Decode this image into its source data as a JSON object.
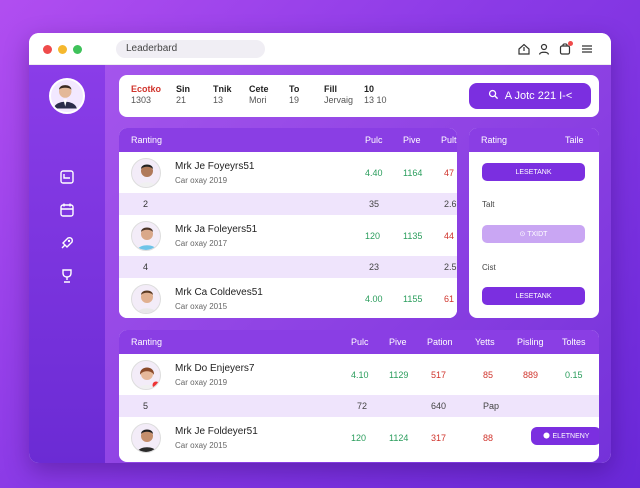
{
  "window": {
    "address": "Leaderbard"
  },
  "stats": [
    {
      "label": "Ecotko",
      "value": "1303"
    },
    {
      "label": "Sin",
      "value": "21"
    },
    {
      "label": "Tnik",
      "value": "13"
    },
    {
      "label": "Cete",
      "value": "Mori"
    },
    {
      "label": "To",
      "value": "19"
    },
    {
      "label": "Fill",
      "value": "Jervaig"
    },
    {
      "label": "10",
      "value": "13 10"
    }
  ],
  "join_button": {
    "label": "A Jotc 221 I-<"
  },
  "top_card": {
    "headers": [
      "Ranting",
      "Pulc",
      "Pive",
      "Pults"
    ],
    "rows": [
      {
        "name": "Mrk Je Foyeyrs51",
        "sub": "Car oxay 2019",
        "v1": "4.40",
        "v2": "1164",
        "v3": "47"
      },
      {
        "rank": "2",
        "v1": "35",
        "v3": "2.6"
      },
      {
        "name": "Mrk Ja Foleyers51",
        "sub": "Car oxay 2017",
        "v1": "120",
        "v2": "1135",
        "v3": "44"
      },
      {
        "rank": "4",
        "v1": "23",
        "v3": "2.5"
      },
      {
        "name": "Mrk Ca Coldeves51",
        "sub": "Car oxay 2015",
        "v1": "4.00",
        "v2": "1155",
        "v3": "61"
      }
    ]
  },
  "side_card": {
    "headers": [
      "Rating",
      "Taile"
    ],
    "btn1": "LESETANK",
    "text1": "Talt",
    "btn2": "⊙ TXIDT",
    "text2": "Cist",
    "btn3": "LESETANK"
  },
  "bottom_card": {
    "headers": [
      "Ranting",
      "Pulc",
      "Pive",
      "Pation",
      "Yetts",
      "Pisling",
      "Toltes"
    ],
    "rows": [
      {
        "name": "Mrk Do Enjeyers7",
        "sub": "Car oxay 2019",
        "v1": "4.10",
        "v2": "1129",
        "v3": "517",
        "v4": "85",
        "v5": "889",
        "v6": "0.15"
      },
      {
        "rank": "5",
        "v1": "72",
        "v3": "640",
        "v4": "Pap"
      },
      {
        "name": "Mrk Je Foldeyer51",
        "sub": "Car oxay 2015",
        "v1": "120",
        "v2": "1124",
        "v3": "317",
        "v4": "88",
        "btn": "ELETNENY"
      }
    ]
  }
}
